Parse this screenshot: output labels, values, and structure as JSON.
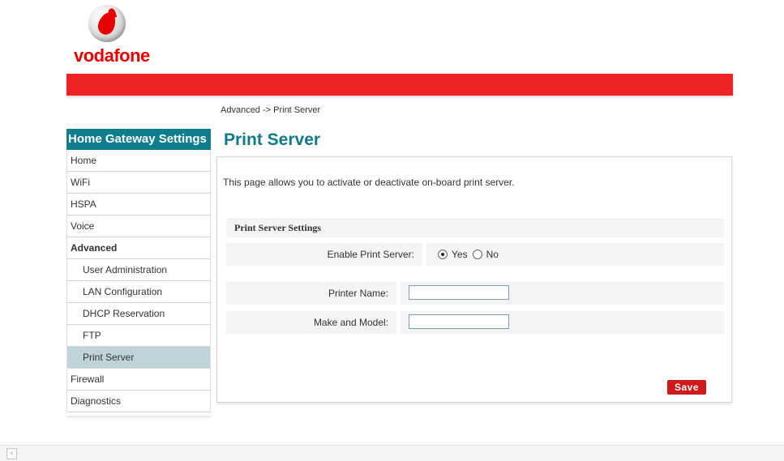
{
  "brand": {
    "name": "vodafone"
  },
  "breadcrumb": "Advanced -> Print Server",
  "sidebar": {
    "title": "Home Gateway Settings",
    "items": [
      {
        "label": "Home",
        "level": 0
      },
      {
        "label": "WiFi",
        "level": 0
      },
      {
        "label": "HSPA",
        "level": 0
      },
      {
        "label": "Voice",
        "level": 0
      },
      {
        "label": "Advanced",
        "level": 0,
        "bold": true
      },
      {
        "label": "User Administration",
        "level": 1
      },
      {
        "label": "LAN Configuration",
        "level": 1
      },
      {
        "label": "DHCP Reservation",
        "level": 1
      },
      {
        "label": "FTP",
        "level": 1
      },
      {
        "label": "Print Server",
        "level": 1,
        "active": true
      },
      {
        "label": "Firewall",
        "level": 0
      },
      {
        "label": "Diagnostics",
        "level": 0
      }
    ]
  },
  "main": {
    "title": "Print Server",
    "description": "This page allows you to activate or deactivate on-board print server.",
    "section_title": "Print Server Settings",
    "enable_label": "Enable Print Server:",
    "enable_options": [
      {
        "label": "Yes",
        "selected": true
      },
      {
        "label": "No",
        "selected": false
      }
    ],
    "printer_name_label": "Printer Name:",
    "printer_name_value": "",
    "make_model_label": "Make and Model:",
    "make_model_value": "",
    "save_label": "Save"
  },
  "colors": {
    "brand_red": "#ee2424",
    "teal": "#0e7e8c",
    "active_item": "#bed4d9",
    "save_button": "#cf1a1a"
  }
}
